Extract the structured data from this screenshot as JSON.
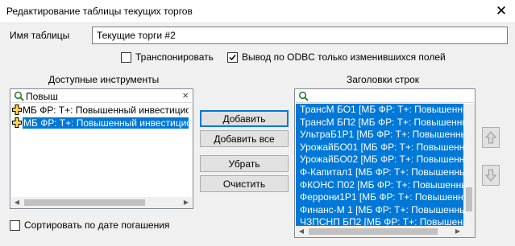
{
  "window": {
    "title": "Редактирование таблицы текущих торгов",
    "close_glyph": "✕"
  },
  "table_name": {
    "label": "Имя таблицы",
    "value": "Текущие торги #2"
  },
  "options": {
    "transpose": {
      "label": "Транспонировать",
      "checked": false
    },
    "odbc": {
      "label": "Вывод по ODBC только изменившихся  полей",
      "checked": true
    }
  },
  "available": {
    "header": "Доступные инструменты",
    "search_value": "Повыш",
    "clear_glyph": "×",
    "items": [
      {
        "label": "МБ ФР: Т+: Повышенный инвестицио",
        "selected": false
      },
      {
        "label": "МБ ФР: Т+: Повышенный инвестицио",
        "selected": true
      }
    ]
  },
  "buttons": {
    "add": "Добавить",
    "add_all": "Добавить все",
    "remove": "Убрать",
    "clear": "Очистить"
  },
  "rows": {
    "header": "Заголовки строк",
    "search_value": "",
    "items": [
      "ТрансМ БО1 [МБ ФР: Т+: Повышенны",
      "ТрансМ БП2 [МБ ФР: Т+: Повышенны",
      "УльтраБ1Р1 [МБ ФР: Т+: Повышенны",
      "УрожайБО01 [МБ ФР: Т+: Повышенны",
      "УрожайБО02 [МБ ФР: Т+: Повышенны",
      "Ф-Капитал1 [МБ ФР: Т+: Повышенны",
      "ФКОНС П02 [МБ ФР: Т+: Повышенны",
      "Феррони1Р1 [МБ ФР: Т+: Повышенны",
      "Финанс-М 1 [МБ ФР: Т+: Повышенны",
      "ЧЗПСНП БП2 [МБ ФР: Т+: Повышенны"
    ]
  },
  "sort_option": {
    "label": "Сортировать по дате погашения",
    "checked": false
  },
  "colors": {
    "selection": "#0078d7",
    "accent_plus": "#2e7d32"
  },
  "icons": [
    "search-icon",
    "clear-icon",
    "plus-icon",
    "arrow-up-icon",
    "arrow-down-icon",
    "close-icon"
  ]
}
